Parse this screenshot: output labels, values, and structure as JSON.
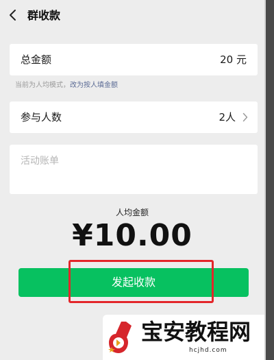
{
  "header": {
    "title": "群收款",
    "back_icon": "chevron-left-icon"
  },
  "total": {
    "label": "总金额",
    "value": "20 元"
  },
  "mode": {
    "text": "当前为人均模式，",
    "link": "改为按人填金额"
  },
  "people": {
    "label": "参与人数",
    "value": "2人",
    "icon": "chevron-right-icon"
  },
  "note": {
    "placeholder": "活动账单"
  },
  "average": {
    "label": "人均金额",
    "amount": "¥10.00"
  },
  "submit": {
    "label": "发起收款"
  },
  "watermark": {
    "text": "宝安教程网",
    "domain": "hcjhd.com"
  },
  "colors": {
    "background": "#ededed",
    "card": "#ffffff",
    "primary_button": "#07c160",
    "link": "#5b6b95",
    "highlight": "#e3262a",
    "placeholder": "#b5b5b5"
  }
}
